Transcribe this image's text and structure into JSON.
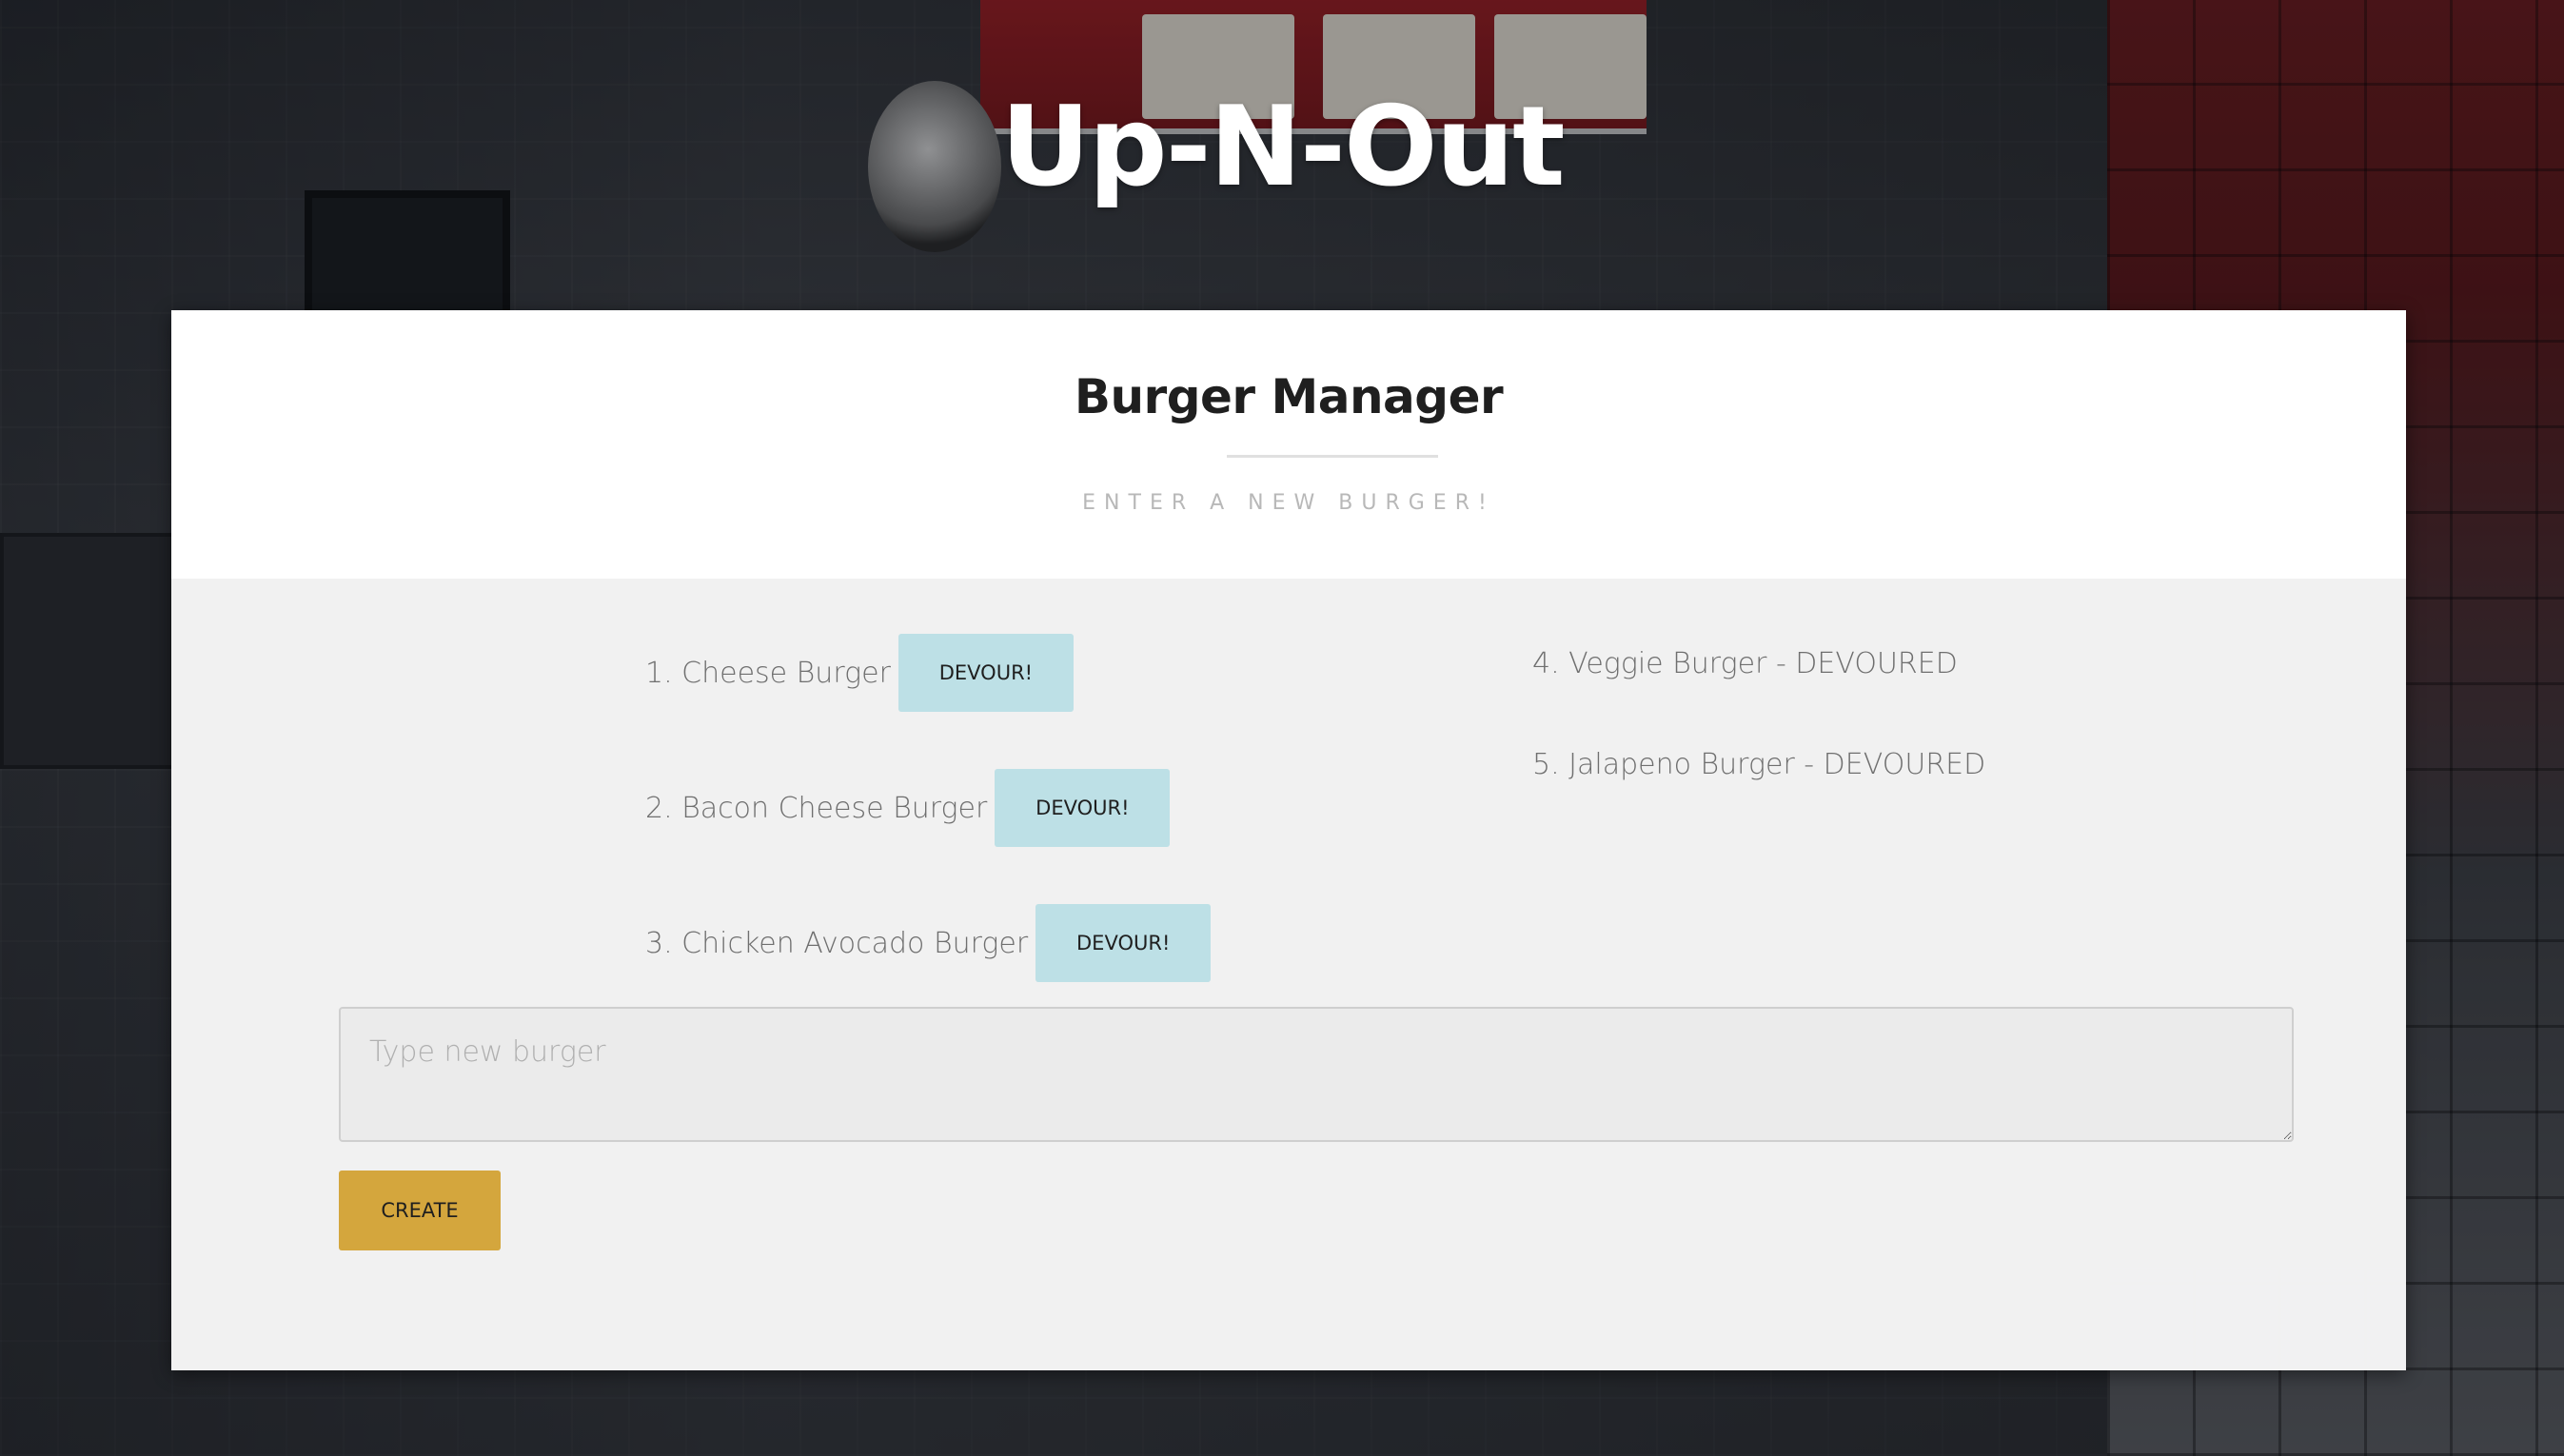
{
  "page": {
    "hero_title": "Up-N-Out"
  },
  "card": {
    "title": "Burger Manager",
    "subtitle": "ENTER A NEW BURGER!"
  },
  "burgers_to_eat": [
    {
      "label": "1. Cheese Burger",
      "button_label": "DEVOUR!"
    },
    {
      "label": "2. Bacon Cheese Burger",
      "button_label": "DEVOUR!"
    },
    {
      "label": "3. Chicken Avocado Burger",
      "button_label": "DEVOUR!"
    }
  ],
  "burgers_devoured": [
    {
      "label": "4. Veggie Burger - DEVOURED"
    },
    {
      "label": "5. Jalapeno Burger - DEVOURED"
    }
  ],
  "form": {
    "placeholder": "Type new burger",
    "value": "",
    "submit_label": "CREATE"
  },
  "colors": {
    "devour_button": "#bde0e6",
    "create_button": "#d4a63d",
    "hero_text": "#ffffff"
  }
}
